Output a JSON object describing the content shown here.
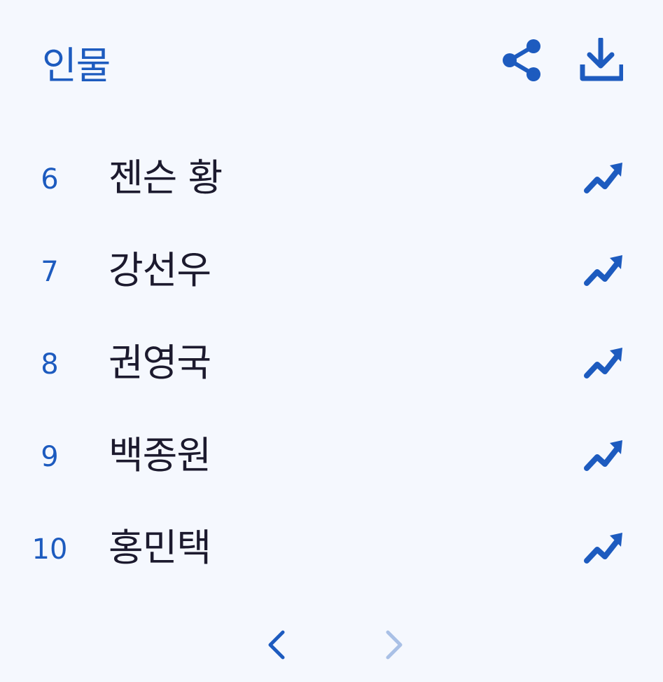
{
  "header": {
    "title": "인물"
  },
  "list": [
    {
      "rank": "6",
      "name": "젠슨 황"
    },
    {
      "rank": "7",
      "name": "강선우"
    },
    {
      "rank": "8",
      "name": "권영국"
    },
    {
      "rank": "9",
      "name": "백종원"
    },
    {
      "rank": "10",
      "name": "홍민택"
    }
  ],
  "icons": {
    "share": "share-icon",
    "download": "download-icon",
    "trend": "trending-up-icon",
    "prev": "chevron-left-icon",
    "next": "chevron-right-icon"
  },
  "colors": {
    "accent": "#1d5bbf",
    "text": "#1c1a2e",
    "background": "#f5f8fe",
    "disabled": "#a9c0e6"
  }
}
